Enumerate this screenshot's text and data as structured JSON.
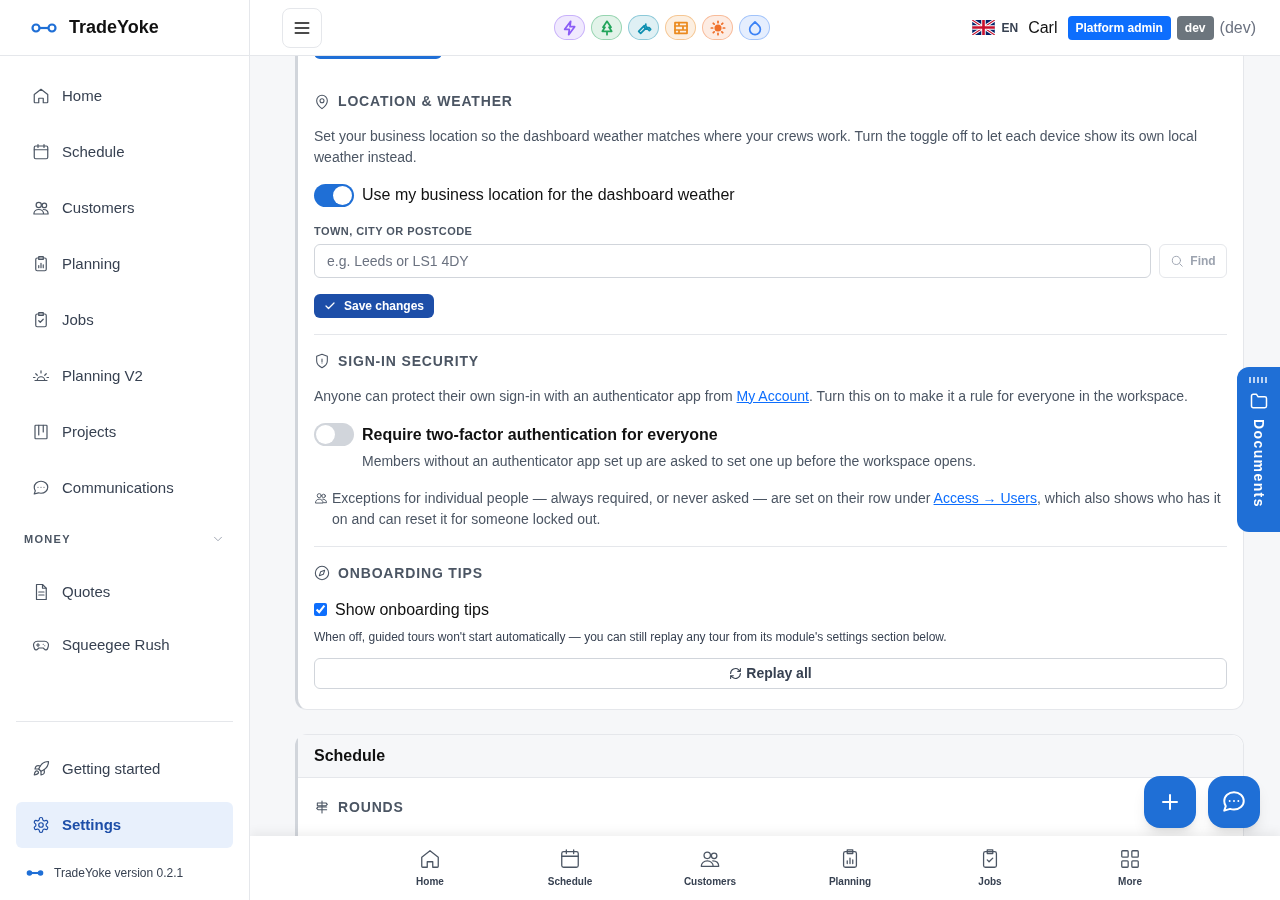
{
  "brand": {
    "name": "TradeYoke"
  },
  "sidebar": {
    "items": [
      {
        "label": "Home",
        "selected": false
      },
      {
        "label": "Schedule",
        "selected": false
      },
      {
        "label": "Customers",
        "selected": false
      },
      {
        "label": "Planning",
        "selected": false
      },
      {
        "label": "Jobs",
        "selected": false
      },
      {
        "label": "Planning V2",
        "selected": false
      },
      {
        "label": "Projects",
        "selected": false
      },
      {
        "label": "Communications",
        "selected": false
      }
    ],
    "group": {
      "label": "MONEY",
      "expanded": true,
      "items": [
        {
          "label": "Quotes",
          "selected": false
        },
        {
          "label": "Squeegee Rush",
          "selected": false
        }
      ]
    },
    "footer_items": [
      {
        "label": "Getting started",
        "selected": false
      },
      {
        "label": "Settings",
        "selected": true
      }
    ],
    "version": "TradeYoke version 0.2.1"
  },
  "topbar": {
    "modules": [
      {
        "color": "#8b5cf6"
      },
      {
        "color": "#22a55b"
      },
      {
        "color": "#0e8fb0"
      },
      {
        "color": "#ea8a1e"
      },
      {
        "color": "#f0702a"
      },
      {
        "color": "#3b82f6"
      }
    ],
    "language": "EN",
    "user": "Carl",
    "role_badge": "Platform admin",
    "env_badge": "dev",
    "env_note": "(dev)"
  },
  "settings_card": {
    "sections": [
      {
        "kind": "location",
        "title": "LOCATION & WEATHER",
        "description": "Set your business location so the dashboard weather matches where your crews work. Turn the toggle off to let each device show its own local weather instead.",
        "toggle": {
          "label": "Use my business location for the dashboard weather",
          "on": true
        },
        "field": {
          "label": "TOWN, CITY OR POSTCODE",
          "placeholder": "e.g. Leeds or LS1 4DY"
        },
        "find_button": "Find",
        "save_button": "Save changes"
      },
      {
        "kind": "security",
        "title": "SIGN-IN SECURITY",
        "description_before": "Anyone can protect their own sign-in with an authenticator app from ",
        "description_link": "My Account",
        "description_after": ". Turn this on to make it a rule for everyone in the workspace.",
        "toggle": {
          "label": "Require two-factor authentication for everyone",
          "hint": "Members without an authenticator app set up are asked to set one up before the workspace opens.",
          "on": false
        },
        "note_before": "Exceptions for individual people — always required, or never asked — are set on their row under ",
        "note_link": "Access → Users",
        "note_after": ", which also shows who has it on and can reset it for someone locked out."
      },
      {
        "kind": "onboarding",
        "title": "ONBOARDING TIPS",
        "checkbox": {
          "label": "Show onboarding tips",
          "checked": true
        },
        "hint": "When off, guided tours won't start automatically — you can still replay any tour from its module's settings section below.",
        "replay_button": "Replay all"
      }
    ]
  },
  "schedule_card": {
    "title": "Schedule",
    "section_title": "ROUNDS"
  },
  "documents_tab": "Documents",
  "bottom_nav": [
    {
      "label": "Home"
    },
    {
      "label": "Schedule"
    },
    {
      "label": "Customers"
    },
    {
      "label": "Planning"
    },
    {
      "label": "Jobs"
    },
    {
      "label": "More"
    }
  ]
}
